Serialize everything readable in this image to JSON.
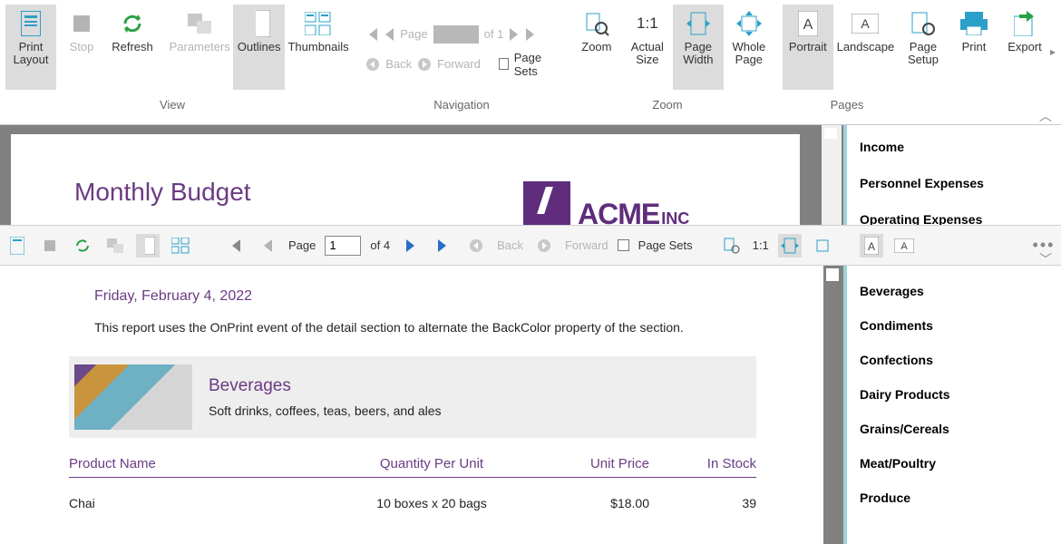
{
  "ribbon": {
    "print_layout": "Print\nLayout",
    "stop": "Stop",
    "refresh": "Refresh",
    "parameters": "Parameters",
    "outlines": "Outlines",
    "thumbnails": "Thumbnails",
    "page_label": "Page",
    "of_label": "of 1",
    "back": "Back",
    "forward": "Forward",
    "page_sets": "Page Sets",
    "zoom": "Zoom",
    "actual_size": "Actual\nSize",
    "onetoone": "1:1",
    "page_width": "Page\nWidth",
    "whole_page": "Whole\nPage",
    "portrait": "Portrait",
    "landscape": "Landscape",
    "page_setup": "Page\nSetup",
    "print": "Print",
    "export": "Export",
    "groups": {
      "view": "View",
      "nav": "Navigation",
      "zoom": "Zoom",
      "pages": "Pages"
    }
  },
  "doc1": {
    "title": "Monthly Budget",
    "brand": "ACME",
    "brand_suffix": "INC"
  },
  "outline1": {
    "items": [
      "Income",
      "Personnel Expenses",
      "Operating Expenses"
    ]
  },
  "tb2": {
    "page_label": "Page",
    "page_value": "1",
    "of_label": "of 4",
    "back": "Back",
    "forward": "Forward",
    "page_sets": "Page Sets",
    "onetoone": "1:1"
  },
  "doc2": {
    "date": "Friday, February 4, 2022",
    "desc": "This report uses the OnPrint event of the detail section to alternate the BackColor property of the section.",
    "category": {
      "name": "Beverages",
      "sub": "Soft drinks, coffees, teas, beers, and ales"
    },
    "cols": {
      "name": "Product Name",
      "qty": "Quantity Per Unit",
      "price": "Unit Price",
      "stock": "In Stock"
    },
    "rows": [
      {
        "name": "Chai",
        "qty": "10 boxes x 20 bags",
        "price": "$18.00",
        "stock": "39"
      }
    ]
  },
  "outline2": {
    "items": [
      "Beverages",
      "Condiments",
      "Confections",
      "Dairy Products",
      "Grains/Cereals",
      "Meat/Poultry",
      "Produce"
    ]
  }
}
